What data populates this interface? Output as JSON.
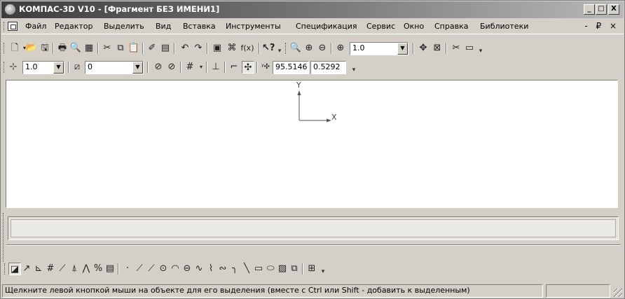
{
  "window": {
    "title": "КОМПАС-3D V10 - [Фрагмент БЕЗ ИМЕНИ1]",
    "app_icon": "kompas-app-icon",
    "controls": {
      "minimize": "_",
      "maximize": "□",
      "close": "X"
    }
  },
  "menu": {
    "items": [
      "Файл",
      "Редактор",
      "Выделить",
      "Вид",
      "Вставка",
      "Инструменты",
      "Спецификация",
      "Сервис",
      "Окно",
      "Справка",
      "Библиотеки"
    ],
    "mdi_controls": "- ₽ ×"
  },
  "toolbar_standard": {
    "icons": [
      "new-document-icon",
      "open-icon",
      "save-icon",
      "print-icon",
      "print-preview-icon",
      "properties-icon",
      "cut-icon",
      "copy-icon",
      "paste-icon",
      "format-brush-icon",
      "table-icon",
      "undo-icon",
      "redo-icon",
      "manager-icon",
      "library-icon",
      "function-fx-icon",
      "context-help-icon",
      "zoom-window-icon",
      "zoom-in-icon",
      "zoom-out-icon",
      "zoom-scale-icon",
      "pan-icon",
      "show-all-icon",
      "refresh-icon",
      "screen-icon"
    ],
    "fx_label": "f(x)",
    "zoom_value": "1.0"
  },
  "toolbar_current_state": {
    "step_value": "1.0",
    "layer_value": "0",
    "coord_x": "95.5146",
    "coord_y": "0.5292"
  },
  "canvas": {
    "axis_y_label": "Y",
    "axis_x_label": "X"
  },
  "bottom_toolbar": {
    "icons": [
      "geometry-icon",
      "dimensions-icon",
      "symbols-icon",
      "edit-icon",
      "parametrization-icon",
      "measure-icon",
      "selection-icon",
      "spec-icon",
      "report-icon",
      "point-icon",
      "auxiliary-line-icon",
      "segment-icon",
      "circle-icon",
      "arc-icon",
      "ellipse-icon",
      "spline-icon",
      "polyline-icon",
      "bezier-icon",
      "fillet-icon",
      "chamfer-icon",
      "rectangle-icon",
      "contour-icon",
      "hatch-icon",
      "equidistant-icon",
      "insert-fragment-icon"
    ]
  },
  "status": {
    "message": "Щелкните левой кнопкой мыши на объекте для его выделения (вместе с Ctrl или Shift - добавить к выделенным)"
  }
}
